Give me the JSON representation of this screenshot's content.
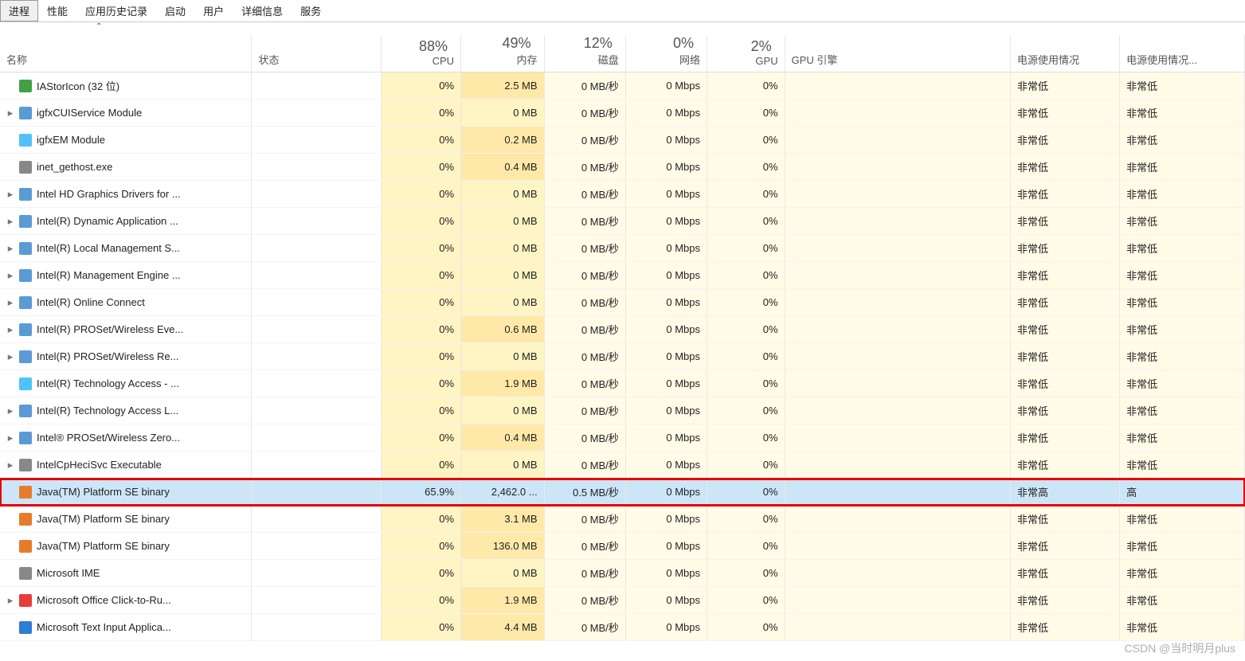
{
  "tabs": [
    "进程",
    "性能",
    "应用历史记录",
    "启动",
    "用户",
    "详细信息",
    "服务"
  ],
  "activeTab": 0,
  "columns": {
    "name": {
      "label": "名称"
    },
    "status": {
      "label": "状态"
    },
    "cpu": {
      "pct": "88%",
      "label": "CPU"
    },
    "mem": {
      "pct": "49%",
      "label": "内存"
    },
    "disk": {
      "pct": "12%",
      "label": "磁盘"
    },
    "net": {
      "pct": "0%",
      "label": "网络"
    },
    "gpu": {
      "pct": "2%",
      "label": "GPU"
    },
    "gpue": {
      "label": "GPU 引擎"
    },
    "pwr": {
      "label": "电源使用情况"
    },
    "pwrt": {
      "label": "电源使用情况..."
    }
  },
  "rows": [
    {
      "exp": "",
      "icon": "ic-green",
      "name": "IAStorIcon (32 位)",
      "cpu": "0%",
      "mem": "2.5 MB",
      "disk": "0 MB/秒",
      "net": "0 Mbps",
      "gpu": "0%",
      "gpue": "",
      "pwr": "非常低",
      "pwrt": "非常低",
      "memCls": "bg-y2",
      "sel": false,
      "hl": false
    },
    {
      "exp": ">",
      "icon": "ic-app",
      "name": "igfxCUIService Module",
      "cpu": "0%",
      "mem": "0 MB",
      "disk": "0 MB/秒",
      "net": "0 Mbps",
      "gpu": "0%",
      "gpue": "",
      "pwr": "非常低",
      "pwrt": "非常低",
      "memCls": "bg-y1",
      "sel": false,
      "hl": false
    },
    {
      "exp": "",
      "icon": "ic-intel",
      "name": "igfxEM Module",
      "cpu": "0%",
      "mem": "0.2 MB",
      "disk": "0 MB/秒",
      "net": "0 Mbps",
      "gpu": "0%",
      "gpue": "",
      "pwr": "非常低",
      "pwrt": "非常低",
      "memCls": "bg-y2",
      "sel": false,
      "hl": false
    },
    {
      "exp": "",
      "icon": "ic-sys",
      "name": "inet_gethost.exe",
      "cpu": "0%",
      "mem": "0.4 MB",
      "disk": "0 MB/秒",
      "net": "0 Mbps",
      "gpu": "0%",
      "gpue": "",
      "pwr": "非常低",
      "pwrt": "非常低",
      "memCls": "bg-y2",
      "sel": false,
      "hl": false
    },
    {
      "exp": ">",
      "icon": "ic-app",
      "name": "Intel HD Graphics Drivers for ...",
      "cpu": "0%",
      "mem": "0 MB",
      "disk": "0 MB/秒",
      "net": "0 Mbps",
      "gpu": "0%",
      "gpue": "",
      "pwr": "非常低",
      "pwrt": "非常低",
      "memCls": "bg-y1",
      "sel": false,
      "hl": false
    },
    {
      "exp": ">",
      "icon": "ic-app",
      "name": "Intel(R) Dynamic Application ...",
      "cpu": "0%",
      "mem": "0 MB",
      "disk": "0 MB/秒",
      "net": "0 Mbps",
      "gpu": "0%",
      "gpue": "",
      "pwr": "非常低",
      "pwrt": "非常低",
      "memCls": "bg-y1",
      "sel": false,
      "hl": false
    },
    {
      "exp": ">",
      "icon": "ic-app",
      "name": "Intel(R) Local Management S...",
      "cpu": "0%",
      "mem": "0 MB",
      "disk": "0 MB/秒",
      "net": "0 Mbps",
      "gpu": "0%",
      "gpue": "",
      "pwr": "非常低",
      "pwrt": "非常低",
      "memCls": "bg-y1",
      "sel": false,
      "hl": false
    },
    {
      "exp": ">",
      "icon": "ic-app",
      "name": "Intel(R) Management Engine ...",
      "cpu": "0%",
      "mem": "0 MB",
      "disk": "0 MB/秒",
      "net": "0 Mbps",
      "gpu": "0%",
      "gpue": "",
      "pwr": "非常低",
      "pwrt": "非常低",
      "memCls": "bg-y1",
      "sel": false,
      "hl": false
    },
    {
      "exp": ">",
      "icon": "ic-app",
      "name": "Intel(R) Online Connect",
      "cpu": "0%",
      "mem": "0 MB",
      "disk": "0 MB/秒",
      "net": "0 Mbps",
      "gpu": "0%",
      "gpue": "",
      "pwr": "非常低",
      "pwrt": "非常低",
      "memCls": "bg-y1",
      "sel": false,
      "hl": false
    },
    {
      "exp": ">",
      "icon": "ic-app",
      "name": "Intel(R) PROSet/Wireless Eve...",
      "cpu": "0%",
      "mem": "0.6 MB",
      "disk": "0 MB/秒",
      "net": "0 Mbps",
      "gpu": "0%",
      "gpue": "",
      "pwr": "非常低",
      "pwrt": "非常低",
      "memCls": "bg-y2",
      "sel": false,
      "hl": false
    },
    {
      "exp": ">",
      "icon": "ic-app",
      "name": "Intel(R) PROSet/Wireless Re...",
      "cpu": "0%",
      "mem": "0 MB",
      "disk": "0 MB/秒",
      "net": "0 Mbps",
      "gpu": "0%",
      "gpue": "",
      "pwr": "非常低",
      "pwrt": "非常低",
      "memCls": "bg-y1",
      "sel": false,
      "hl": false
    },
    {
      "exp": "",
      "icon": "ic-intel",
      "name": "Intel(R) Technology Access - ...",
      "cpu": "0%",
      "mem": "1.9 MB",
      "disk": "0 MB/秒",
      "net": "0 Mbps",
      "gpu": "0%",
      "gpue": "",
      "pwr": "非常低",
      "pwrt": "非常低",
      "memCls": "bg-y2",
      "sel": false,
      "hl": false
    },
    {
      "exp": ">",
      "icon": "ic-app",
      "name": "Intel(R) Technology Access L...",
      "cpu": "0%",
      "mem": "0 MB",
      "disk": "0 MB/秒",
      "net": "0 Mbps",
      "gpu": "0%",
      "gpue": "",
      "pwr": "非常低",
      "pwrt": "非常低",
      "memCls": "bg-y1",
      "sel": false,
      "hl": false
    },
    {
      "exp": ">",
      "icon": "ic-app",
      "name": "Intel® PROSet/Wireless Zero...",
      "cpu": "0%",
      "mem": "0.4 MB",
      "disk": "0 MB/秒",
      "net": "0 Mbps",
      "gpu": "0%",
      "gpue": "",
      "pwr": "非常低",
      "pwrt": "非常低",
      "memCls": "bg-y2",
      "sel": false,
      "hl": false
    },
    {
      "exp": ">",
      "icon": "ic-sys",
      "name": "IntelCpHeciSvc Executable",
      "cpu": "0%",
      "mem": "0 MB",
      "disk": "0 MB/秒",
      "net": "0 Mbps",
      "gpu": "0%",
      "gpue": "",
      "pwr": "非常低",
      "pwrt": "非常低",
      "memCls": "bg-y1",
      "sel": false,
      "hl": false
    },
    {
      "exp": "",
      "icon": "ic-java",
      "name": "Java(TM) Platform SE binary",
      "cpu": "65.9%",
      "mem": "2,462.0 ...",
      "disk": "0.5 MB/秒",
      "net": "0 Mbps",
      "gpu": "0%",
      "gpue": "",
      "pwr": "非常高",
      "pwrt": "高",
      "memCls": "",
      "sel": true,
      "hl": true
    },
    {
      "exp": "",
      "icon": "ic-java",
      "name": "Java(TM) Platform SE binary",
      "cpu": "0%",
      "mem": "3.1 MB",
      "disk": "0 MB/秒",
      "net": "0 Mbps",
      "gpu": "0%",
      "gpue": "",
      "pwr": "非常低",
      "pwrt": "非常低",
      "memCls": "bg-y2",
      "sel": false,
      "hl": false
    },
    {
      "exp": "",
      "icon": "ic-java",
      "name": "Java(TM) Platform SE binary",
      "cpu": "0%",
      "mem": "136.0 MB",
      "disk": "0 MB/秒",
      "net": "0 Mbps",
      "gpu": "0%",
      "gpue": "",
      "pwr": "非常低",
      "pwrt": "非常低",
      "memCls": "bg-y2",
      "sel": false,
      "hl": false
    },
    {
      "exp": "",
      "icon": "ic-sys",
      "name": "Microsoft IME",
      "cpu": "0%",
      "mem": "0 MB",
      "disk": "0 MB/秒",
      "net": "0 Mbps",
      "gpu": "0%",
      "gpue": "",
      "pwr": "非常低",
      "pwrt": "非常低",
      "memCls": "bg-y1",
      "sel": false,
      "hl": false
    },
    {
      "exp": ">",
      "icon": "ic-off",
      "name": "Microsoft Office Click-to-Ru...",
      "cpu": "0%",
      "mem": "1.9 MB",
      "disk": "0 MB/秒",
      "net": "0 Mbps",
      "gpu": "0%",
      "gpue": "",
      "pwr": "非常低",
      "pwrt": "非常低",
      "memCls": "bg-y2",
      "sel": false,
      "hl": false
    },
    {
      "exp": "",
      "icon": "ic-blue",
      "name": "Microsoft Text Input Applica...",
      "cpu": "0%",
      "mem": "4.4 MB",
      "disk": "0 MB/秒",
      "net": "0 Mbps",
      "gpu": "0%",
      "gpue": "",
      "pwr": "非常低",
      "pwrt": "非常低",
      "memCls": "bg-y2",
      "sel": false,
      "hl": false
    }
  ],
  "watermark": "CSDN @当时明月plus"
}
